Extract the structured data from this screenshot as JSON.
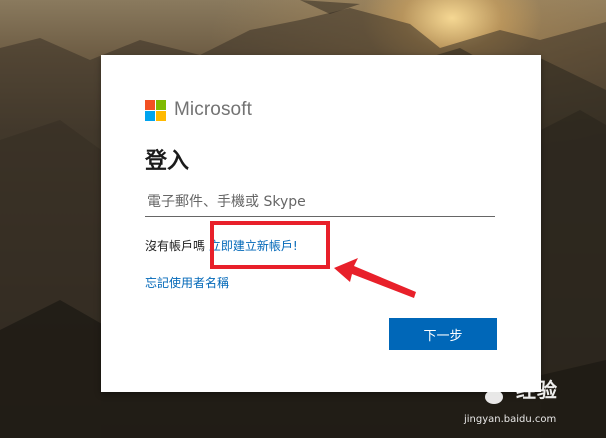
{
  "brand": {
    "name": "Microsoft",
    "colors": [
      "#f25022",
      "#7fba00",
      "#00a4ef",
      "#ffb900"
    ]
  },
  "signin": {
    "title": "登入",
    "email_placeholder": "電子郵件、手機或 Skype",
    "no_account_text": "沒有帳戶嗎",
    "create_account_link": "立即建立新帳戶!",
    "forgot_username_link": "忘記使用者名稱",
    "next_button": "下一步"
  },
  "colors": {
    "link": "#0067b8",
    "primary_button": "#0067b8",
    "annotation": "#e8202a"
  },
  "watermark": {
    "title": "经验",
    "url": "jingyan.baidu.com"
  }
}
